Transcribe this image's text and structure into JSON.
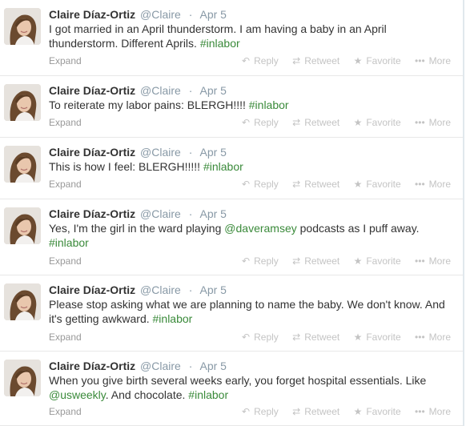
{
  "actions": {
    "expand": "Expand",
    "reply": "Reply",
    "retweet": "Retweet",
    "favorite": "Favorite",
    "more": "More",
    "reply_icon": "reply-arrow-icon",
    "retweet_icon": "retweet-arrows-icon",
    "favorite_icon": "star-icon",
    "more_icon": "ellipsis-dots-icon"
  },
  "colors": {
    "hashtag": "#3a8a3a",
    "mention": "#3a8a3a",
    "muted": "#8899a6"
  },
  "tweets": [
    {
      "name": "Claire Díaz-Ortiz",
      "handle": "@Claire",
      "sep": "·",
      "date": "Apr 5",
      "parts": [
        {
          "t": "text",
          "v": "I got married in an April thunderstorm. I am having a baby in an April thunderstorm. Different Aprils. "
        },
        {
          "t": "hashtag",
          "v": "#inlabor"
        }
      ]
    },
    {
      "name": "Claire Díaz-Ortiz",
      "handle": "@Claire",
      "sep": "·",
      "date": "Apr 5",
      "parts": [
        {
          "t": "text",
          "v": "To reiterate my labor pains: BLERGH!!!! "
        },
        {
          "t": "hashtag",
          "v": "#inlabor"
        }
      ]
    },
    {
      "name": "Claire Díaz-Ortiz",
      "handle": "@Claire",
      "sep": "·",
      "date": "Apr 5",
      "parts": [
        {
          "t": "text",
          "v": "This is how I feel: BLERGH!!!!! "
        },
        {
          "t": "hashtag",
          "v": "#inlabor"
        }
      ]
    },
    {
      "name": "Claire Díaz-Ortiz",
      "handle": "@Claire",
      "sep": "·",
      "date": "Apr 5",
      "parts": [
        {
          "t": "text",
          "v": "Yes, I'm the girl in the ward playing "
        },
        {
          "t": "mention",
          "v": "@daveramsey"
        },
        {
          "t": "text",
          "v": " podcasts as I puff away. "
        },
        {
          "t": "hashtag",
          "v": "#inlabor"
        }
      ]
    },
    {
      "name": "Claire Díaz-Ortiz",
      "handle": "@Claire",
      "sep": "·",
      "date": "Apr 5",
      "parts": [
        {
          "t": "text",
          "v": "Please stop asking what we are planning to name the baby. We don't know. And it's getting awkward. "
        },
        {
          "t": "hashtag",
          "v": "#inlabor"
        }
      ]
    },
    {
      "name": "Claire Díaz-Ortiz",
      "handle": "@Claire",
      "sep": "·",
      "date": "Apr 5",
      "parts": [
        {
          "t": "text",
          "v": "When you give birth several weeks early, you forget hospital essentials. Like "
        },
        {
          "t": "mention",
          "v": "@usweekly"
        },
        {
          "t": "text",
          "v": ". And chocolate. "
        },
        {
          "t": "hashtag",
          "v": "#inlabor"
        }
      ]
    }
  ]
}
